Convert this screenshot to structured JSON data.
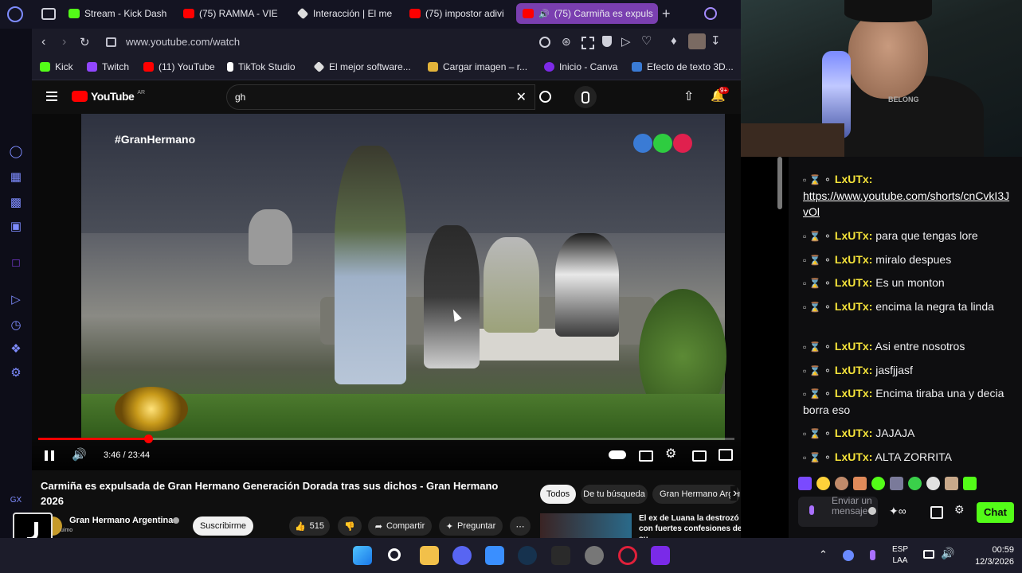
{
  "browser": {
    "tabs": [
      {
        "label": "Stream - Kick Dash",
        "icon": "kick-icon",
        "color": "#53fc18"
      },
      {
        "label": "(75) RAMMA - VIE",
        "icon": "youtube-icon",
        "color": "#ff0000"
      },
      {
        "label": "Interacción | El me",
        "icon": "diamond-icon",
        "color": "#ffffff"
      },
      {
        "label": "(75) impostor adivi",
        "icon": "youtube-icon",
        "color": "#ff0000"
      },
      {
        "label": "(75) Carmiña es expuls",
        "icon": "youtube-icon",
        "color": "#ff0000"
      }
    ],
    "active_tab_color": "#7a3fb0",
    "url": "www.youtube.com/watch",
    "bookmarks": [
      {
        "label": "Kick",
        "color": "#53fc18"
      },
      {
        "label": "Twitch",
        "color": "#9146ff"
      },
      {
        "label": "(11) YouTube",
        "color": "#ff0000"
      },
      {
        "label": "TikTok Studio",
        "color": "#ffffff"
      },
      {
        "label": "El mejor software...",
        "color": "#ffffff"
      },
      {
        "label": "Cargar imagen – r...",
        "color": "#e2b33a"
      },
      {
        "label": "Inicio - Canva",
        "color": "#7d2ae8"
      },
      {
        "label": "Efecto de texto 3D...",
        "color": "#3a7bd5"
      }
    ]
  },
  "youtube": {
    "logo": "YouTube",
    "region": "AR",
    "search_value": "gh",
    "notifications": "9+",
    "video": {
      "overlay_hashtag": "#GranHermano",
      "time": "3:46 / 23:44",
      "progress": 0.1584
    },
    "title": "Carmiña es expulsada de Gran Hermano Generación Dorada tras sus dichos - Gran Hermano 2026",
    "channel": "Gran Hermano Argentina",
    "channel_sub": "uimo",
    "subscribe": "Suscribirme",
    "likes": "515",
    "share": "Compartir",
    "ask": "Preguntar",
    "chips": [
      "Todos",
      "De tu búsqueda",
      "Gran Hermano Argen"
    ],
    "suggestion": "El ex de Luana la destrozó con fuertes confesiones de su ..."
  },
  "chat": {
    "messages": [
      {
        "user": "LxUTx:",
        "text": "https://www.youtube.com/shorts/cnCvkI3JvOl",
        "link": true
      },
      {
        "user": "LxUTx:",
        "text": "para que tengas lore"
      },
      {
        "user": "LxUTx:",
        "text": "miralo despues"
      },
      {
        "user": "LxUTx:",
        "text": "Es un monton"
      },
      {
        "user": "LxUTx:",
        "text": "encima la negra ta linda"
      },
      {
        "user": "LxUTx:",
        "text": "Asi entre nosotros"
      },
      {
        "user": "LxUTx:",
        "text": "jasfjjasf"
      },
      {
        "user": "LxUTx:",
        "text": "Encima tiraba una y decia borra eso"
      },
      {
        "user": "LxUTx:",
        "text": "JAJAJA"
      },
      {
        "user": "LxUTx:",
        "text": "ALTA ZORRITA"
      }
    ],
    "input_placeholder": "Enviar un mensaje",
    "send_label": "Chat",
    "send_color": "#53fc18"
  },
  "taskbar": {
    "lang": "ESP",
    "lang_sub": "LAA",
    "time": "00:59",
    "date": "12/3/2026"
  }
}
